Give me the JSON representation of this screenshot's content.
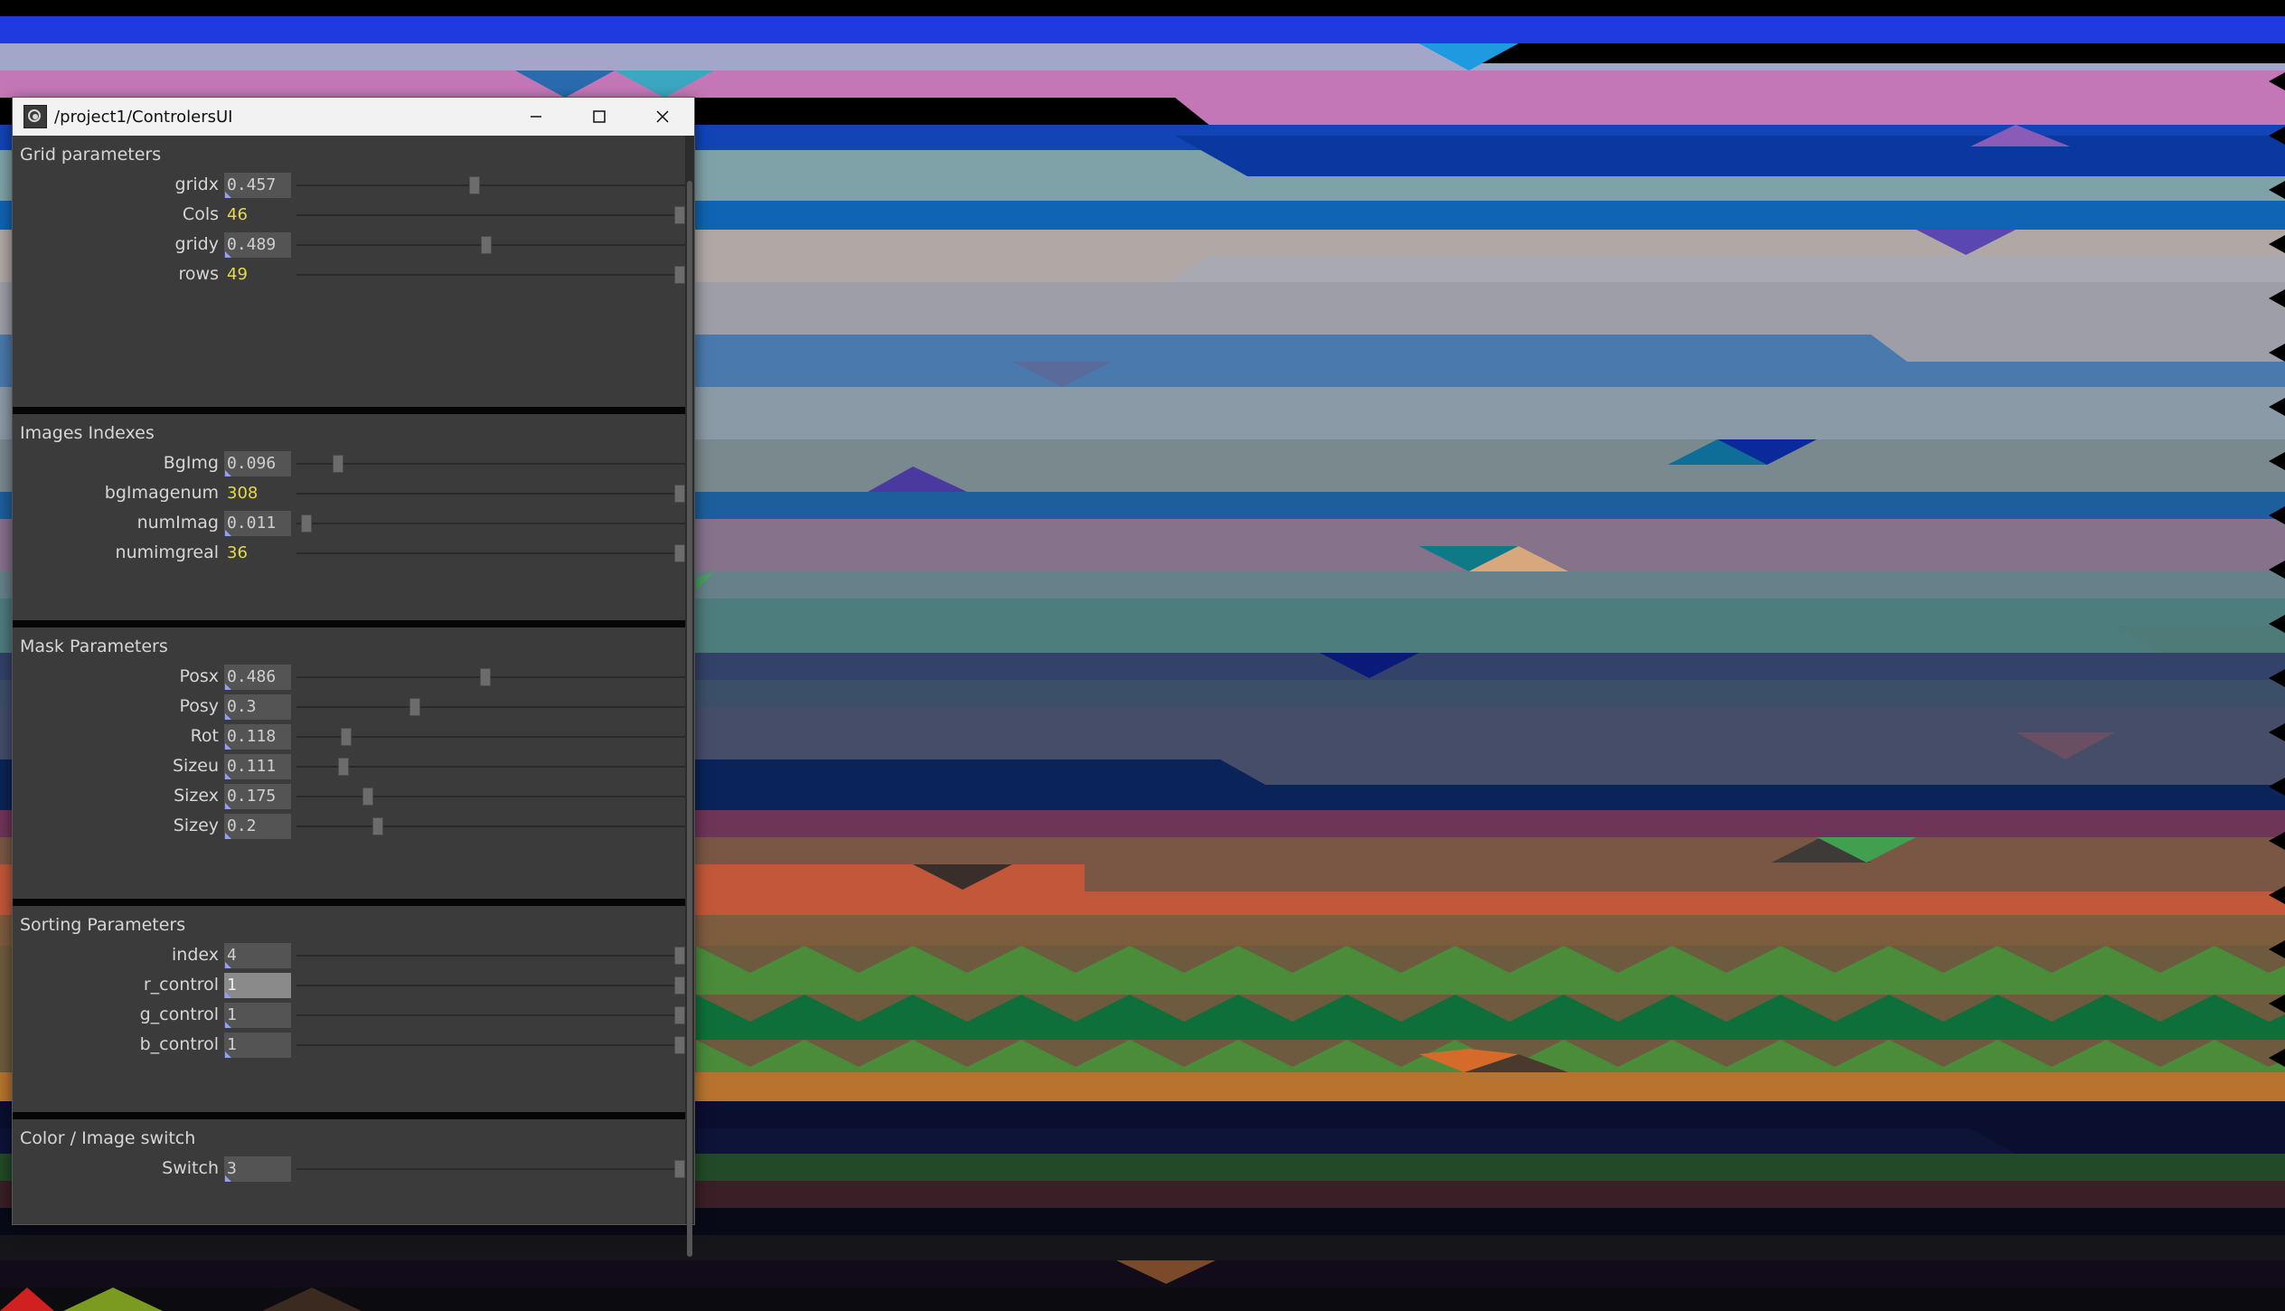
{
  "window": {
    "title": "/project1/ControlersUI",
    "minimize_icon": "minimize-icon",
    "maximize_icon": "maximize-icon",
    "close_icon": "close-icon"
  },
  "sections": {
    "grid": {
      "title": "Grid parameters",
      "params": [
        {
          "label": "gridx",
          "value": "0.457",
          "level": 0.457
        },
        {
          "label": "Cols",
          "value": "46",
          "level": 1
        },
        {
          "label": "gridy",
          "value": "0.489",
          "level": 0.489
        },
        {
          "label": "rows",
          "value": "49",
          "level": 1
        }
      ]
    },
    "images": {
      "title": "Images Indexes",
      "params": [
        {
          "label": "BgImg",
          "value": "0.096",
          "level": 0.096
        },
        {
          "label": "bgImagenum",
          "value": "308",
          "level": 1
        },
        {
          "label": "numImag",
          "value": "0.011",
          "level": 0.011
        },
        {
          "label": "numimgreal",
          "value": "36",
          "level": 1
        }
      ]
    },
    "mask": {
      "title": "Mask Parameters",
      "params": [
        {
          "label": "Posx",
          "value": "0.486",
          "level": 0.486
        },
        {
          "label": "Posy",
          "value": "0.3",
          "level": 0.3
        },
        {
          "label": "Rot",
          "value": "0.118",
          "level": 0.118
        },
        {
          "label": "Sizeu",
          "value": "0.111",
          "level": 0.111
        },
        {
          "label": "Sizex",
          "value": "0.175",
          "level": 0.175
        },
        {
          "label": "Sizey",
          "value": "0.2",
          "level": 0.2
        }
      ]
    },
    "sorting": {
      "title": "Sorting Parameters",
      "params": [
        {
          "label": "index",
          "value": "4",
          "level": 1
        },
        {
          "label": "r_control",
          "value": "1",
          "level": 1
        },
        {
          "label": "g_control",
          "value": "1",
          "level": 1
        },
        {
          "label": "b_control",
          "value": "1",
          "level": 1
        }
      ]
    },
    "switch": {
      "title": "Color / Image switch",
      "params": [
        {
          "label": "Switch",
          "value": "3",
          "level": 1
        }
      ]
    }
  },
  "colors": {
    "panel": "#3b3b3b",
    "field": "#545454",
    "int_value": "#e6d84c",
    "label": "#d6d6d6"
  }
}
